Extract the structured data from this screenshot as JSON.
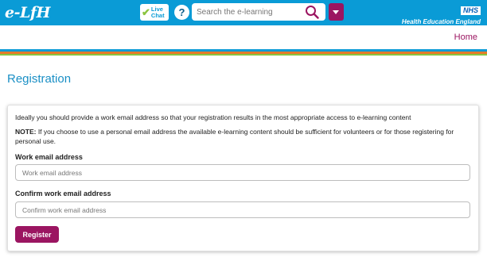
{
  "header": {
    "logo_text": "e-LfH",
    "live_chat": {
      "line1": "Live",
      "line2": "Chat"
    },
    "help_symbol": "?",
    "search": {
      "placeholder": "Search the e-learning",
      "value": ""
    },
    "nhs": {
      "badge": "NHS",
      "org": "Health Education England"
    }
  },
  "nav": {
    "home": "Home"
  },
  "page": {
    "title": "Registration"
  },
  "form": {
    "intro": "Ideally you should provide a work email address so that your registration results in the most appropriate access to e-learning content",
    "note_label": "NOTE:",
    "note_text": " If you choose to use a personal email address the available e-learning content should be sufficient for volunteers or for those registering for personal use.",
    "work_email_label": "Work email address",
    "work_email_placeholder": "Work email address",
    "work_email_value": "",
    "confirm_label": "Confirm work email address",
    "confirm_placeholder": "Confirm work email address",
    "confirm_value": "",
    "register_button": "Register"
  },
  "colors": {
    "header_bg": "#0a9bd6",
    "accent": "#9b1561",
    "title": "#1a8fc5",
    "stripe_blue": "#0a9bd6",
    "stripe_orange": "#e47b2a",
    "stripe_green": "#8ac43f"
  },
  "icons": {
    "search": "magnifier-icon",
    "menu": "chevron-down-icon",
    "chat": "checkmark-icon"
  }
}
